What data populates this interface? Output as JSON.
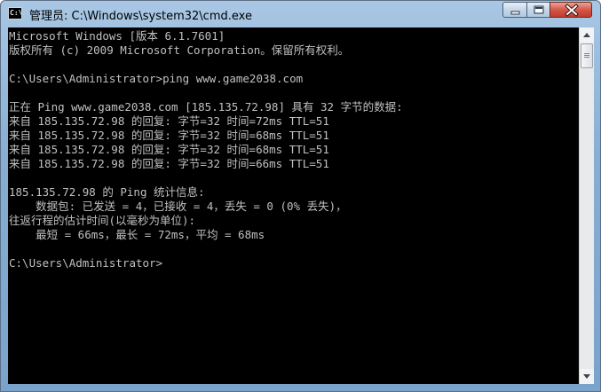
{
  "window": {
    "icon_text": "C:\\",
    "title": "管理员: C:\\Windows\\system32\\cmd.exe"
  },
  "console": {
    "lines": [
      "Microsoft Windows [版本 6.1.7601]",
      "版权所有 (c) 2009 Microsoft Corporation。保留所有权利。",
      "",
      "C:\\Users\\Administrator>ping www.game2038.com",
      "",
      "正在 Ping www.game2038.com [185.135.72.98] 具有 32 字节的数据:",
      "来自 185.135.72.98 的回复: 字节=32 时间=72ms TTL=51",
      "来自 185.135.72.98 的回复: 字节=32 时间=68ms TTL=51",
      "来自 185.135.72.98 的回复: 字节=32 时间=68ms TTL=51",
      "来自 185.135.72.98 的回复: 字节=32 时间=66ms TTL=51",
      "",
      "185.135.72.98 的 Ping 统计信息:",
      "    数据包: 已发送 = 4，已接收 = 4，丢失 = 0 (0% 丢失)，",
      "往返行程的估计时间(以毫秒为单位):",
      "    最短 = 66ms，最长 = 72ms，平均 = 68ms",
      "",
      "C:\\Users\\Administrator>"
    ]
  },
  "icons": {
    "app": "cmd-icon",
    "minimize": "minimize-icon",
    "maximize": "maximize-icon",
    "close": "close-icon",
    "scroll_up": "arrow-up-icon",
    "scroll_down": "arrow-down-icon"
  },
  "colors": {
    "console_background": "#000000",
    "console_text": "#c0c0c0",
    "close_button": "#c94536"
  }
}
